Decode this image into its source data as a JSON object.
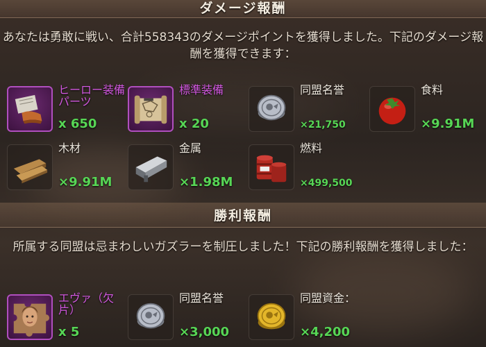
{
  "damage_section": {
    "title": "ダメージ報酬",
    "description": "あなたは勇敢に戦い、合計558343のダメージポイントを獲得しました。下記のダメージ報酬を獲得できます：",
    "rewards": [
      {
        "name": "ヒーロー装備パーツ",
        "amount": "x 650",
        "icon": "hero-equipment-parts-icon",
        "rarity": "purple"
      },
      {
        "name": "標準装備",
        "amount": "x 20",
        "icon": "standard-equipment-blueprint-icon",
        "rarity": "purple"
      },
      {
        "name": "同盟名誉",
        "amount": "×21,750",
        "icon": "alliance-honor-coin-icon",
        "rarity": "normal"
      },
      {
        "name": "食料",
        "amount": "×9.91M",
        "icon": "tomato-food-icon",
        "rarity": "normal"
      },
      {
        "name": "木材",
        "amount": "×9.91M",
        "icon": "wood-planks-icon",
        "rarity": "normal"
      },
      {
        "name": "金属",
        "amount": "×1.98M",
        "icon": "metal-ingot-icon",
        "rarity": "normal"
      },
      {
        "name": "燃料",
        "amount": "×499,500",
        "icon": "fuel-barrels-icon",
        "rarity": "normal"
      }
    ]
  },
  "victory_section": {
    "title": "勝利報酬",
    "description": "所属する同盟は忌まわしいガズラーを制圧しました！下記の勝利報酬を獲得しました：",
    "rewards": [
      {
        "name": "エヴァ（欠片）",
        "amount": "x 5",
        "icon": "eva-hero-fragment-icon",
        "rarity": "purple"
      },
      {
        "name": "同盟名誉",
        "amount": "×3,000",
        "icon": "alliance-honor-coin-icon",
        "rarity": "normal"
      },
      {
        "name": "同盟資金：",
        "amount": "×4,200",
        "icon": "alliance-funds-coin-icon",
        "rarity": "normal"
      }
    ]
  },
  "colors": {
    "amount_green": "#57d655",
    "purple_label": "#d258e0",
    "purple_frame": "#b04fbf"
  }
}
